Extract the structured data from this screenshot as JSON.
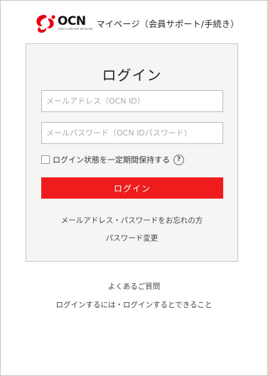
{
  "header": {
    "logo_text": "OCN",
    "logo_subtext": "OPEN COMPUTER NETWORK",
    "title": "マイページ（会員サポート/手続き）",
    "brand_color": "#e60012"
  },
  "login": {
    "title": "ログイン",
    "mail_placeholder": "メールアドレス（OCN ID）",
    "mail_value": "",
    "password_placeholder": "メールパスワード（OCN IDパスワード）",
    "password_value": "",
    "remember_label": "ログイン状態を一定期間保持する",
    "remember_checked": false,
    "help_icon_glyph": "?",
    "button_label": "ログイン",
    "button_color": "#ee1c1c",
    "forgot_link": "メールアドレス・パスワードをお忘れの方",
    "change_password_link": "パスワード変更"
  },
  "footer": {
    "faq_link": "よくあるご質問",
    "howto_link": "ログインするには・ログインするとできること"
  },
  "icons": {
    "logo": "ocn-logo-icon",
    "checkbox": "checkbox-icon",
    "help": "help-circle-icon"
  }
}
